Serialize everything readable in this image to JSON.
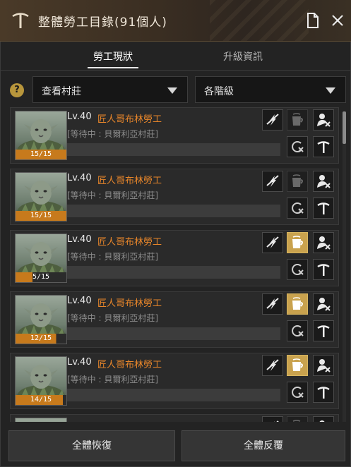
{
  "window": {
    "title": "整體勞工目錄(91個人)"
  },
  "tabs": [
    {
      "label": "勞工現狀"
    },
    {
      "label": "升級資訊"
    }
  ],
  "filters": {
    "village": "查看村莊",
    "grade": "各階級"
  },
  "workers": [
    {
      "level": "Lv.40",
      "name": "匠人哥布林勞工",
      "status": "[等待中 : 貝爾利亞村莊]",
      "stamina": "15/15",
      "stamina_fraction": 1.0,
      "potion_active": false
    },
    {
      "level": "Lv.40",
      "name": "匠人哥布林勞工",
      "status": "[等待中 : 貝爾利亞村莊]",
      "stamina": "15/15",
      "stamina_fraction": 1.0,
      "potion_active": false
    },
    {
      "level": "Lv.40",
      "name": "匠人哥布林勞工",
      "status": "[等待中 : 貝爾利亞村莊]",
      "stamina": "5/15",
      "stamina_fraction": 0.33,
      "potion_active": true
    },
    {
      "level": "Lv.40",
      "name": "匠人哥布林勞工",
      "status": "[等待中 : 貝爾利亞村莊]",
      "stamina": "12/15",
      "stamina_fraction": 0.8,
      "potion_active": true
    },
    {
      "level": "Lv.40",
      "name": "匠人哥布林勞工",
      "status": "[等待中 : 貝爾利亞村莊]",
      "stamina": "14/15",
      "stamina_fraction": 0.93,
      "potion_active": true
    }
  ],
  "buttons": {
    "recover_all": "全體恢復",
    "repeat_all": "全體反覆"
  },
  "colors": {
    "accent_orange": "#e8862a",
    "potion_active": "#c9a24e",
    "stamina_bar": "#c77a1c"
  }
}
